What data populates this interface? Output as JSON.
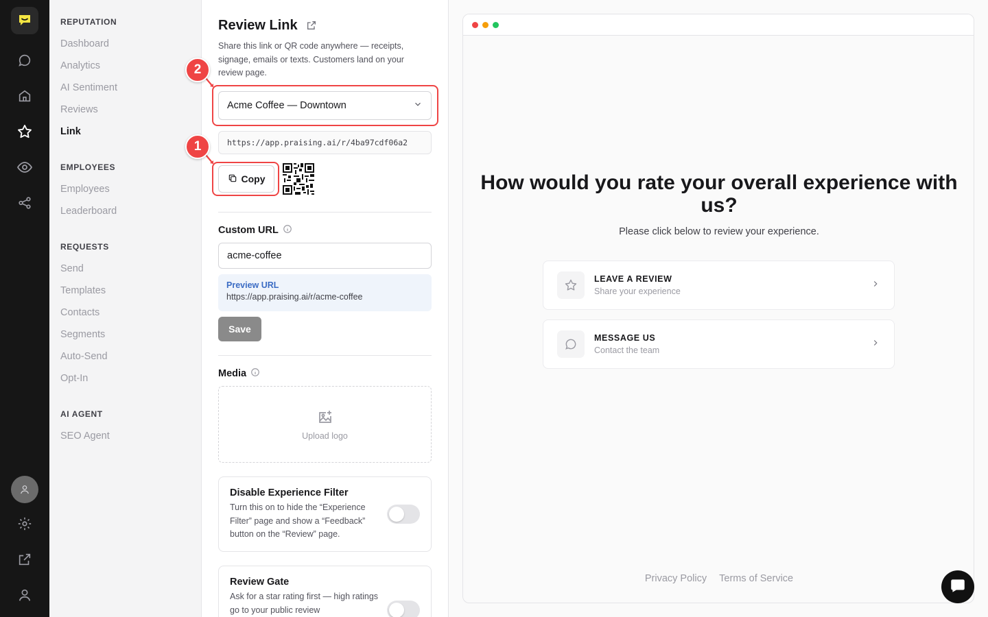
{
  "rail": {
    "icons": [
      "logo-icon",
      "chat-icon",
      "home-icon",
      "star-icon",
      "eye-icon",
      "share-icon",
      "avatar-icon",
      "gear-icon",
      "external-link-icon",
      "user-icon"
    ]
  },
  "nav": {
    "sections": [
      {
        "title": "REPUTATION",
        "items": [
          "Dashboard",
          "Analytics",
          "AI Sentiment",
          "Reviews",
          "Link"
        ]
      },
      {
        "title": "EMPLOYEES",
        "items": [
          "Employees",
          "Leaderboard"
        ]
      },
      {
        "title": "REQUESTS",
        "items": [
          "Send",
          "Templates",
          "Contacts",
          "Segments",
          "Auto-Send",
          "Opt-In"
        ]
      },
      {
        "title": "AI AGENT",
        "items": [
          "SEO Agent"
        ]
      }
    ],
    "active": "Link"
  },
  "panel": {
    "title": "Review Link",
    "description": "Share this link or QR code anywhere — receipts, signage, emails or texts. Customers land on your review page.",
    "location_select": "Acme Coffee — Downtown",
    "review_url": "https://app.praising.ai/r/4ba97cdf06a2",
    "copy_label": "Copy",
    "custom_url_label": "Custom URL",
    "custom_url_value": "acme-coffee",
    "preview_label": "Preview URL",
    "preview_value": "https://app.praising.ai/r/acme-coffee",
    "save_label": "Save",
    "media_label": "Media",
    "upload_label": "Upload logo",
    "cards": [
      {
        "title": "Disable Experience Filter",
        "desc": "Turn this on to hide the “Experience Filter” page and show a “Feedback” button on the “Review” page.",
        "enabled": false
      },
      {
        "title": "Review Gate",
        "desc": "Ask for a star rating first — high ratings go to your public review",
        "enabled": false
      }
    ]
  },
  "annotations": [
    {
      "number": "1",
      "target": "copy-button"
    },
    {
      "number": "2",
      "target": "location-select"
    }
  ],
  "preview": {
    "heading": "How would you rate your overall experience with us?",
    "subtitle": "Please click below to review your experience.",
    "options": [
      {
        "title": "LEAVE A REVIEW",
        "subtitle": "Share your experience",
        "icon": "star-icon"
      },
      {
        "title": "MESSAGE US",
        "subtitle": "Contact the team",
        "icon": "chat-bubble-icon"
      }
    ],
    "footer_links": [
      "Privacy Policy",
      "Terms of Service"
    ]
  },
  "colors": {
    "accent": "#ef4444",
    "rail": "#161616",
    "logo": "#f5e642"
  }
}
